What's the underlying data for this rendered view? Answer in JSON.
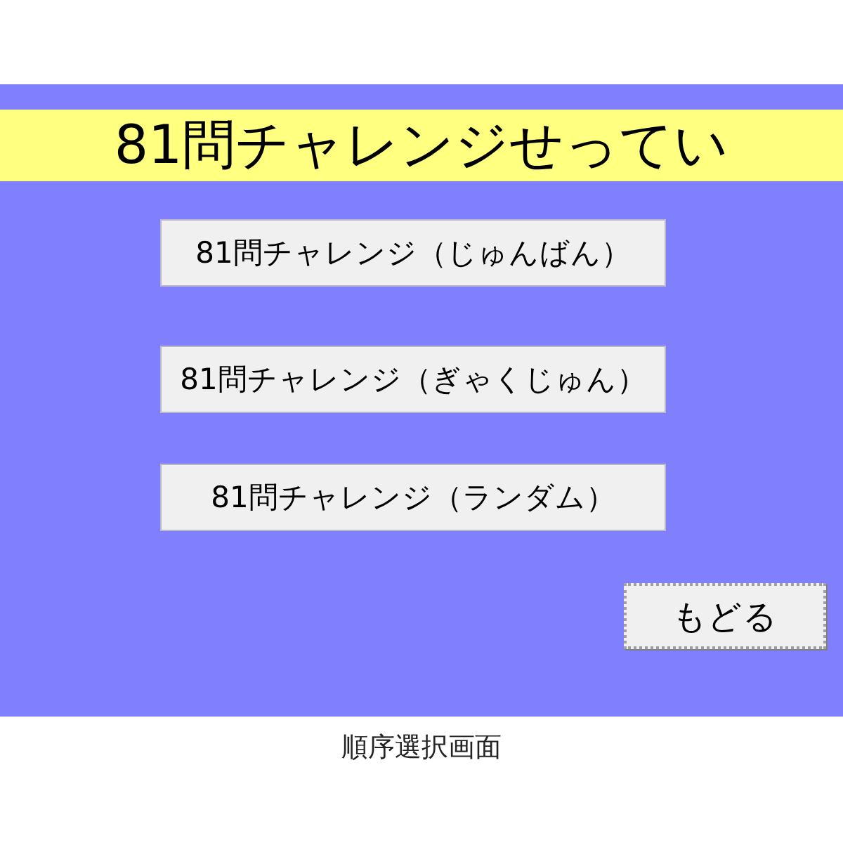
{
  "title": "81問チャレンジせってい",
  "buttons": [
    {
      "label": "81問チャレンジ（じゅんばん）"
    },
    {
      "label": "81問チャレンジ（ぎゃくじゅん）"
    },
    {
      "label": "81問チャレンジ（ランダム）"
    }
  ],
  "back_button": {
    "label": "もどる",
    "focused": true
  },
  "caption": "順序選択画面"
}
